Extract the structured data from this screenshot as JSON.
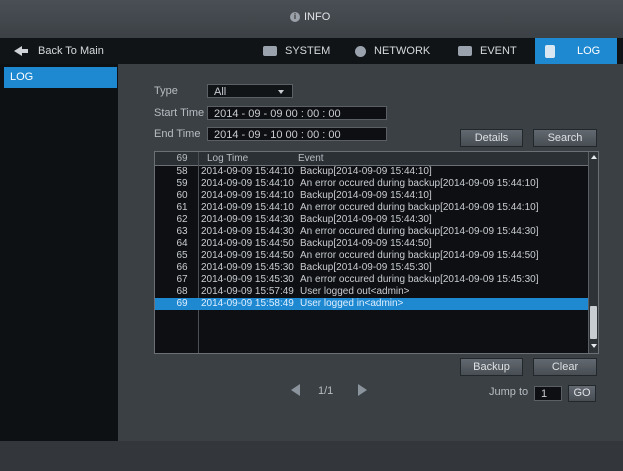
{
  "header": {
    "title": "INFO"
  },
  "nav": {
    "back_label": "Back To Main",
    "tabs": [
      {
        "label": "SYSTEM"
      },
      {
        "label": "NETWORK"
      },
      {
        "label": "EVENT"
      },
      {
        "label": "LOG",
        "active": true
      }
    ]
  },
  "sidebar": {
    "items": [
      {
        "label": "LOG",
        "active": true
      }
    ]
  },
  "filters": {
    "type_label": "Type",
    "type_value": "All",
    "start_label": "Start Time",
    "start_value": "2014 - 09 - 09    00 : 00 : 00",
    "end_label": "End Time",
    "end_value": "2014 - 09 - 10    00 : 00 : 00",
    "details_button": "Details",
    "search_button": "Search"
  },
  "table": {
    "count_header": "69",
    "time_header": "Log Time",
    "event_header": "Event",
    "rows": [
      {
        "idx": "58",
        "time": "2014-09-09 15:44:10",
        "event": "Backup[2014-09-09 15:44:10]"
      },
      {
        "idx": "59",
        "time": "2014-09-09 15:44:10",
        "event": "An error occured during backup[2014-09-09 15:44:10]"
      },
      {
        "idx": "60",
        "time": "2014-09-09 15:44:10",
        "event": "Backup[2014-09-09 15:44:10]"
      },
      {
        "idx": "61",
        "time": "2014-09-09 15:44:10",
        "event": "An error occured during backup[2014-09-09 15:44:10]"
      },
      {
        "idx": "62",
        "time": "2014-09-09 15:44:30",
        "event": "Backup[2014-09-09 15:44:30]"
      },
      {
        "idx": "63",
        "time": "2014-09-09 15:44:30",
        "event": "An error occured during backup[2014-09-09 15:44:30]"
      },
      {
        "idx": "64",
        "time": "2014-09-09 15:44:50",
        "event": "Backup[2014-09-09 15:44:50]"
      },
      {
        "idx": "65",
        "time": "2014-09-09 15:44:50",
        "event": "An error occured during backup[2014-09-09 15:44:50]"
      },
      {
        "idx": "66",
        "time": "2014-09-09 15:45:30",
        "event": "Backup[2014-09-09 15:45:30]"
      },
      {
        "idx": "67",
        "time": "2014-09-09 15:45:30",
        "event": "An error occured during backup[2014-09-09 15:45:30]"
      },
      {
        "idx": "68",
        "time": "2014-09-09 15:57:49",
        "event": "User logged out<admin>"
      },
      {
        "idx": "69",
        "time": "2014-09-09 15:58:49",
        "event": "User logged in<admin>",
        "selected": true
      }
    ]
  },
  "actions": {
    "backup_button": "Backup",
    "clear_button": "Clear"
  },
  "pager": {
    "page_text": "1/1",
    "jump_label": "Jump to",
    "jump_value": "1",
    "go_button": "GO"
  },
  "colors": {
    "accent": "#1e88d0"
  },
  "icons": {
    "info": "info-icon",
    "back": "back-arrow-icon",
    "system": "monitor-icon",
    "network": "globe-icon",
    "event": "event-icon",
    "log": "log-icon"
  }
}
